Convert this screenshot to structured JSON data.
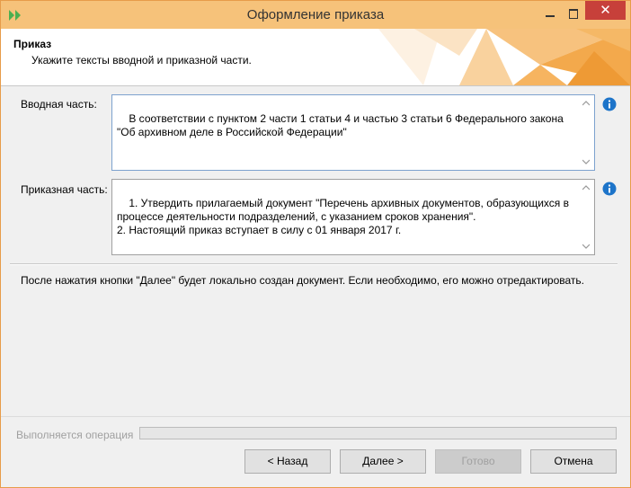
{
  "window": {
    "title": "Оформление приказа",
    "close_glyph": "✕"
  },
  "header": {
    "title": "Приказ",
    "subtitle": "Укажите тексты вводной и приказной части."
  },
  "intro": {
    "label": "Вводная часть:",
    "text": "В соответствии с пунктом 2 части 1 статьи 4 и частью 3 статьи 6 Федерального закона \"Об архивном деле в Российской Федерации\""
  },
  "order": {
    "label": "Приказная часть:",
    "text": "1. Утвердить прилагаемый документ \"Перечень архивных документов, образующихся в процессе деятельности подразделений, с указанием сроков хранения\".\n2. Настоящий приказ вступает в силу с 01 января 2017 г."
  },
  "status_text": "После нажатия кнопки \"Далее\" будет локально создан документ. Если необходимо, его можно отредактировать.",
  "operation": {
    "label": "Выполняется операция",
    "progress": 0
  },
  "buttons": {
    "back": "< Назад",
    "next": "Далее >",
    "finish": "Готово",
    "cancel": "Отмена"
  },
  "icons": {
    "app": "double-chevron-right-icon",
    "info": "info-icon"
  },
  "colors": {
    "titlebar": "#f6c27a",
    "close": "#c7403a",
    "accent": "#4caf50",
    "info": "#1d74c9"
  }
}
